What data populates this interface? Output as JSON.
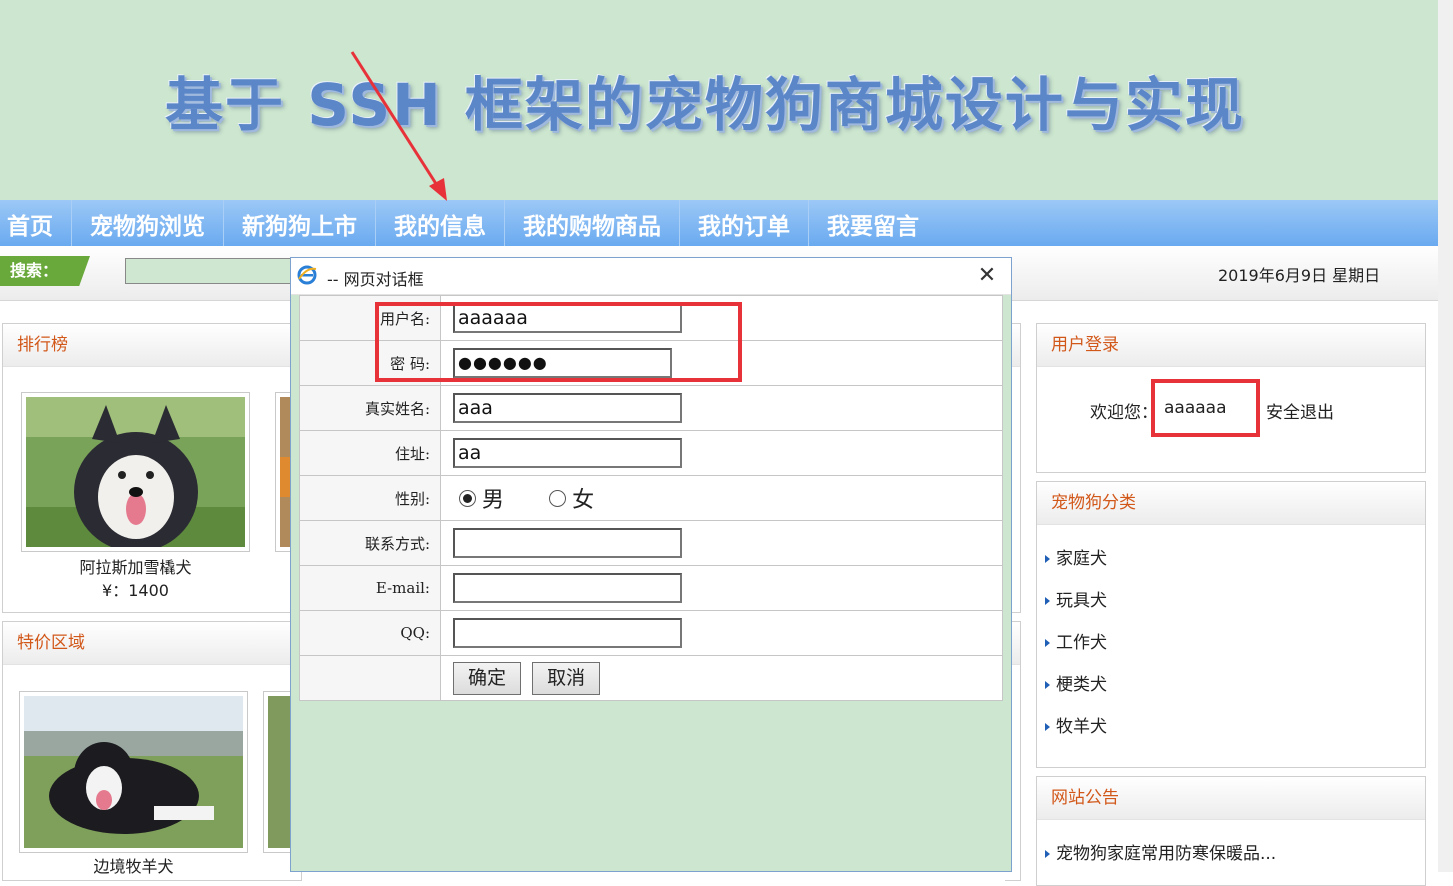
{
  "banner": {
    "title": "基于 SSH 框架的宠物狗商城设计与实现"
  },
  "nav": {
    "items": [
      "首页",
      "宠物狗浏览",
      "新狗狗上市",
      "我的信息",
      "我的购物商品",
      "我的订单",
      "我要留言"
    ]
  },
  "search": {
    "label": "搜索：",
    "date": "2019年6月9日 星期日"
  },
  "ranking": {
    "title": "排行榜",
    "items": [
      {
        "name": "阿拉斯加雪橇犬",
        "price": "¥：1400"
      }
    ]
  },
  "special": {
    "title": "特价区域",
    "items": [
      {
        "name": "边境牧羊犬"
      }
    ]
  },
  "login": {
    "title": "用户登录",
    "welcome": "欢迎您：",
    "username": "aaaaaa",
    "logout": "安全退出"
  },
  "categories": {
    "title": "宠物狗分类",
    "items": [
      "家庭犬",
      "玩具犬",
      "工作犬",
      "梗类犬",
      "牧羊犬"
    ]
  },
  "notice": {
    "title": "网站公告",
    "items": [
      "宠物狗家庭常用防寒保暖品..."
    ]
  },
  "dialog": {
    "title": "-- 网页对话框",
    "fields": {
      "username_label": "用户名:",
      "username_value": "aaaaaa",
      "password_label": "密 码:",
      "password_value": "●●●●●●",
      "realname_label": "真实姓名:",
      "realname_value": "aaa",
      "address_label": "住址:",
      "address_value": "aa",
      "gender_label": "性别:",
      "gender_male": "男",
      "gender_female": "女",
      "contact_label": "联系方式:",
      "contact_value": "",
      "email_label": "E-mail:",
      "email_value": "",
      "qq_label": "QQ:",
      "qq_value": ""
    },
    "confirm_label": "确定",
    "cancel_label": "取消"
  },
  "colors": {
    "banner_bg": "#cce6cf",
    "nav_bg": "#7ab4f3",
    "panel_title": "#d2581a",
    "highlight": "#e8323a"
  }
}
